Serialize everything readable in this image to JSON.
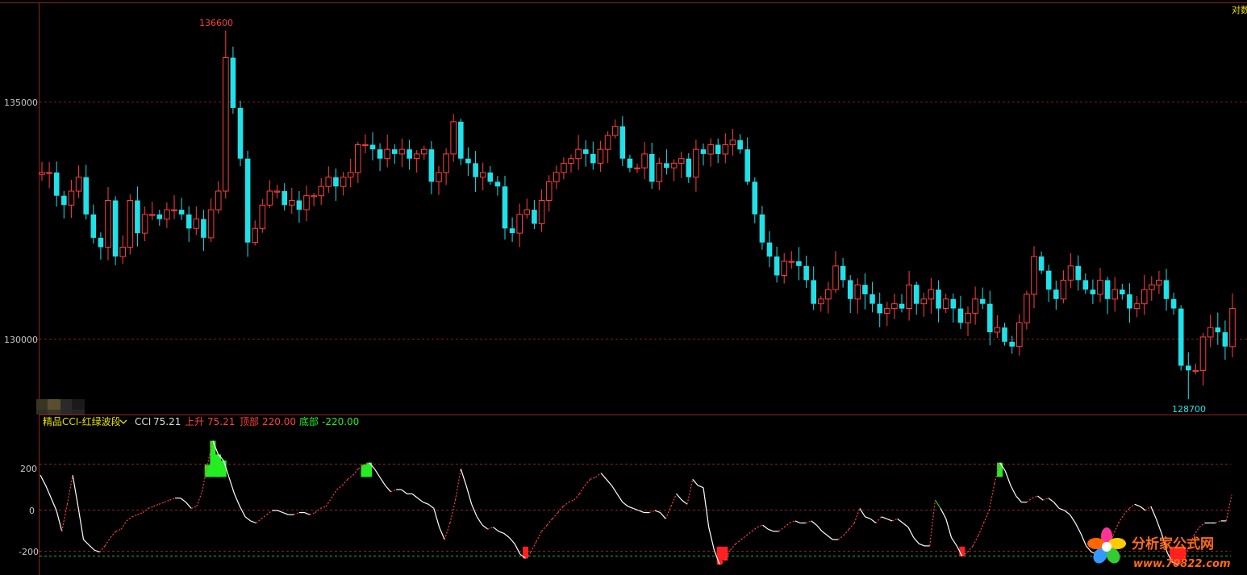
{
  "colors": {
    "background": "#000000",
    "up": "#ff3f3f",
    "down": "#20e0e8",
    "grid": "#7a1c1c",
    "frame": "#8c2323",
    "axis_text": "#c8c8c8",
    "cci_line": "#ffffff",
    "top_marker": "#22ee22",
    "bottom_marker": "#ff2020",
    "bottom_line": "#22bb22",
    "mode_text": "#e8e000",
    "indicator_name": "#e8e000"
  },
  "main_panel": {
    "mode_label": "对数",
    "y_ticks": [
      "135000",
      "130000"
    ],
    "high_label": "136600",
    "low_label": "128700"
  },
  "indicator_panel": {
    "name": "精品CCI-红绿波段",
    "dropdown_icon": "chevron-down-icon",
    "values": [
      {
        "label": "CCI",
        "value": "75.21",
        "color": "#dcdcdc"
      },
      {
        "label": "上升",
        "value": "75.21",
        "color": "#ff3f3f"
      },
      {
        "label": "顶部",
        "value": "220.00",
        "color": "#ff3f3f"
      },
      {
        "label": "底部",
        "value": "-220.00",
        "color": "#22ee22"
      }
    ],
    "y_ticks": [
      "200",
      "0",
      "-200"
    ]
  },
  "watermark": {
    "logo_icon": "flower-logo-icon",
    "title": "分析家公式网",
    "url": "www.70822.com"
  },
  "chart_data": [
    {
      "type": "candlestick",
      "y_scale": "log",
      "ylim": [
        128400,
        137200
      ],
      "y_ticks": [
        135000,
        130000
      ],
      "high": 136600,
      "low": 128700,
      "close": [
        133500,
        133500,
        133000,
        132800,
        133100,
        133400,
        132600,
        132100,
        131900,
        132900,
        131700,
        131900,
        132900,
        132200,
        132600,
        132600,
        132500,
        132700,
        132700,
        132600,
        132300,
        132500,
        132100,
        132700,
        133100,
        136000,
        134900,
        133800,
        132000,
        132300,
        132800,
        133100,
        133100,
        132800,
        132900,
        132700,
        133000,
        133000,
        133200,
        133400,
        133200,
        133400,
        133500,
        134100,
        134100,
        134000,
        133800,
        134000,
        133900,
        134000,
        133800,
        133900,
        134000,
        133300,
        133500,
        133900,
        134600,
        133800,
        133700,
        133400,
        133500,
        133300,
        133200,
        132300,
        132200,
        132600,
        132700,
        132400,
        132900,
        133300,
        133500,
        133700,
        133800,
        134000,
        133900,
        133700,
        134000,
        134300,
        134500,
        133800,
        133600,
        133600,
        133900,
        133300,
        133700,
        133600,
        133700,
        133800,
        133400,
        134000,
        133900,
        134100,
        133900,
        134100,
        134200,
        134000,
        133300,
        132600,
        132000,
        131700,
        131300,
        131600,
        131600,
        131500,
        131200,
        130700,
        130800,
        131000,
        131500,
        131200,
        130800,
        131100,
        130900,
        130700,
        130500,
        130600,
        130700,
        130600,
        131100,
        130700,
        130800,
        131000,
        130600,
        130800,
        130600,
        130300,
        130500,
        130800,
        130700,
        130100,
        130200,
        129900,
        129800,
        130300,
        130900,
        131700,
        131400,
        131000,
        130800,
        131200,
        131500,
        131200,
        131000,
        130900,
        131200,
        130800,
        131000,
        130900,
        130600,
        130700,
        131000,
        131100,
        131200,
        130800,
        130600,
        129400,
        129300,
        129300,
        130000,
        130200,
        130100,
        129800,
        130600
      ]
    },
    {
      "type": "line",
      "name": "CCI",
      "ylim": [
        -310,
        380
      ],
      "y_ticks": [
        200,
        0,
        -200
      ],
      "top_level": 220,
      "bottom_level": -220,
      "values": [
        170,
        120,
        60,
        0,
        -100,
        30,
        170,
        20,
        -140,
        -165,
        -190,
        -200,
        -170,
        -130,
        -100,
        -90,
        -50,
        -30,
        -20,
        -10,
        10,
        20,
        30,
        40,
        50,
        60,
        60,
        40,
        10,
        20,
        90,
        220,
        335,
        270,
        240,
        160,
        80,
        20,
        -30,
        -50,
        -60,
        -40,
        -20,
        0,
        0,
        -10,
        -20,
        -20,
        -10,
        -10,
        -20,
        -10,
        10,
        20,
        60,
        100,
        120,
        150,
        170,
        200,
        220,
        230,
        200,
        160,
        120,
        90,
        100,
        100,
        80,
        80,
        60,
        40,
        30,
        10,
        -80,
        -140,
        -60,
        50,
        200,
        120,
        30,
        -30,
        -70,
        -90,
        -80,
        -100,
        -110,
        -130,
        -160,
        -210,
        -230,
        -200,
        -150,
        -100,
        -70,
        -40,
        -10,
        20,
        40,
        50,
        80,
        120,
        150,
        160,
        180,
        150,
        120,
        80,
        40,
        20,
        10,
        0,
        -10,
        -10,
        0,
        -10,
        -40,
        20,
        80,
        50,
        30,
        150,
        120,
        110,
        -80,
        -190,
        -260,
        -240,
        -190,
        -160,
        -140,
        -120,
        -100,
        -80,
        -70,
        -90,
        -100,
        -100,
        -80,
        -60,
        -50,
        -60,
        -60,
        -50,
        -70,
        -100,
        -120,
        -140,
        -140,
        -120,
        -90,
        -60,
        10,
        -30,
        -40,
        -60,
        -30,
        -40,
        -50,
        -40,
        -60,
        -80,
        -130,
        -160,
        -170,
        -170,
        50,
        10,
        -40,
        -130,
        -170,
        -220,
        -200,
        -170,
        -120,
        -60,
        0,
        130,
        230,
        190,
        120,
        70,
        40,
        40,
        60,
        70,
        50,
        60,
        40,
        10,
        0,
        -20,
        -60,
        -110,
        -170,
        -200,
        -210,
        -230,
        -190,
        -120,
        -60,
        -20,
        10,
        30,
        20,
        0,
        20,
        -40,
        -110,
        -200,
        -250,
        -260,
        -240,
        -180,
        -120,
        -80,
        -60,
        -60,
        -60,
        -50,
        -50,
        75.21
      ]
    }
  ]
}
